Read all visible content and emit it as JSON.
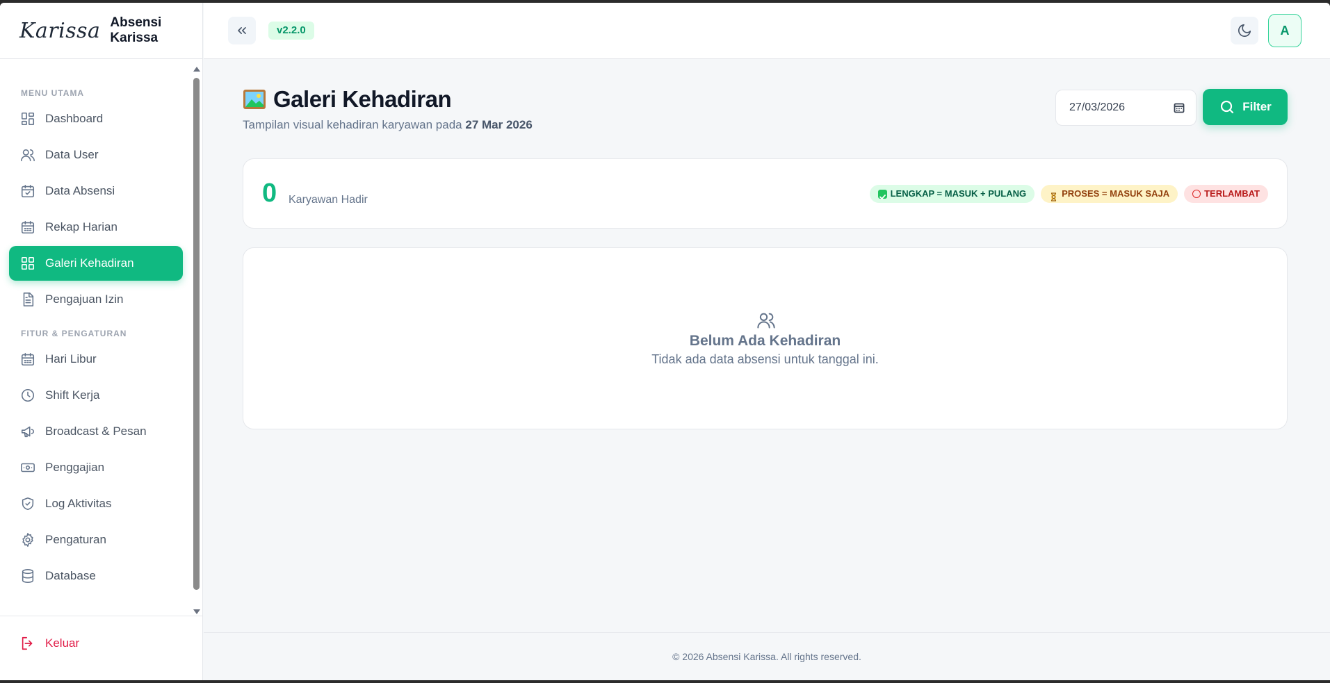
{
  "brand": {
    "logo": "Karissa",
    "name": "Absensi Karissa"
  },
  "topbar": {
    "version": "v2.2.0",
    "avatar_initial": "A"
  },
  "sidebar": {
    "section_main": "MENU UTAMA",
    "section_settings": "FITUR & PENGATURAN",
    "items": [
      {
        "label": "Dashboard",
        "icon": "grid-icon"
      },
      {
        "label": "Data User",
        "icon": "users-icon"
      },
      {
        "label": "Data Absensi",
        "icon": "calendar-check-icon"
      },
      {
        "label": "Rekap Harian",
        "icon": "calendar-icon"
      },
      {
        "label": "Galeri Kehadiran",
        "icon": "grid-icon",
        "active": true
      },
      {
        "label": "Pengajuan Izin",
        "icon": "document-icon"
      },
      {
        "label": "Hari Libur",
        "icon": "calendar-icon"
      },
      {
        "label": "Shift Kerja",
        "icon": "clock-icon"
      },
      {
        "label": "Broadcast & Pesan",
        "icon": "megaphone-icon"
      },
      {
        "label": "Penggajian",
        "icon": "money-icon"
      },
      {
        "label": "Log Aktivitas",
        "icon": "shield-icon"
      },
      {
        "label": "Pengaturan",
        "icon": "gear-icon"
      },
      {
        "label": "Database",
        "icon": "database-icon"
      }
    ],
    "logout": "Keluar"
  },
  "page": {
    "title": "Galeri Kehadiran",
    "subtitle_prefix": "Tampilan visual kehadiran karyawan pada",
    "subtitle_date": "27 Mar 2026",
    "date_value": "27/03/2026",
    "filter_label": "Filter"
  },
  "stats": {
    "count": "0",
    "label": "Karyawan Hadir",
    "legend": {
      "complete": "LENGKAP = MASUK + PULANG",
      "process": "PROSES = MASUK SAJA",
      "late": "TERLAMBAT"
    }
  },
  "empty": {
    "title": "Belum Ada Kehadiran",
    "description": "Tidak ada data absensi untuk tanggal ini."
  },
  "footer": {
    "text": "© 2026 Absensi Karissa. All rights reserved."
  },
  "colors": {
    "accent": "#10b981",
    "danger": "#e11d48"
  }
}
